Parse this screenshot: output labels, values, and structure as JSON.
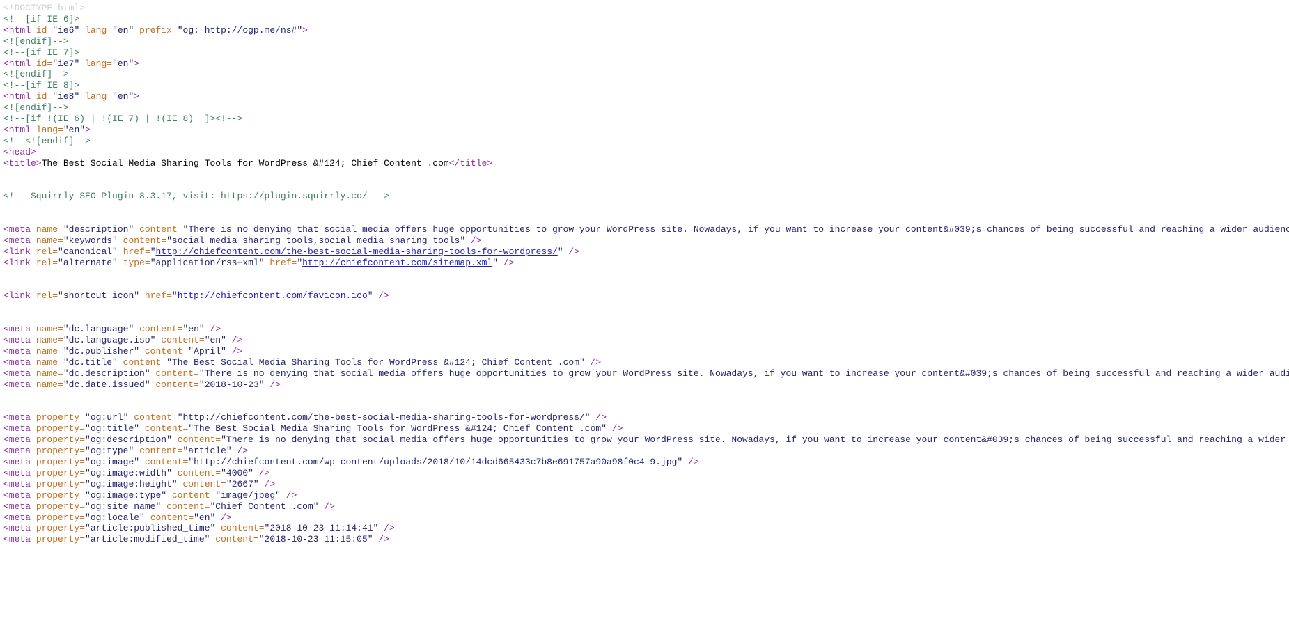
{
  "view": {
    "kind": "view-source",
    "title": "view-source page showing raw HTML of a WordPress article",
    "colors": {
      "background": "#ffffff",
      "doctype": "#cfcfcf",
      "comment": "#3f7f5f",
      "tag": "#8b2fa0",
      "attribute_name": "#c07020",
      "attribute_value": "#25256e",
      "hyperlink": "#2020c0"
    }
  },
  "source": {
    "lines": [
      {
        "id": 1,
        "type": "doctype",
        "text": "<!DOCTYPE html>"
      },
      {
        "id": 2,
        "type": "comment",
        "text": "<!--[if IE 6]>"
      },
      {
        "id": 3,
        "type": "tag",
        "tagname": "html",
        "attrs": [
          [
            "id",
            "ie6"
          ],
          [
            "lang",
            "en"
          ],
          [
            "prefix",
            "og: http://ogp.me/ns#"
          ]
        ],
        "close": ">"
      },
      {
        "id": 4,
        "type": "comment",
        "text": "<![endif]-->"
      },
      {
        "id": 5,
        "type": "comment",
        "text": "<!--[if IE 7]>"
      },
      {
        "id": 6,
        "type": "tag",
        "tagname": "html",
        "attrs": [
          [
            "id",
            "ie7"
          ],
          [
            "lang",
            "en"
          ]
        ],
        "close": ">"
      },
      {
        "id": 7,
        "type": "comment",
        "text": "<![endif]-->"
      },
      {
        "id": 8,
        "type": "comment",
        "text": "<!--[if IE 8]>"
      },
      {
        "id": 9,
        "type": "tag",
        "tagname": "html",
        "attrs": [
          [
            "id",
            "ie8"
          ],
          [
            "lang",
            "en"
          ]
        ],
        "close": ">"
      },
      {
        "id": 10,
        "type": "comment",
        "text": "<![endif]-->"
      },
      {
        "id": 11,
        "type": "comment",
        "text": "<!--[if !(IE 6) | !(IE 7) | !(IE 8)  ]><!-->"
      },
      {
        "id": 12,
        "type": "tag",
        "tagname": "html",
        "attrs": [
          [
            "lang",
            "en"
          ]
        ],
        "close": ">"
      },
      {
        "id": 13,
        "type": "comment",
        "text": "<!--<![endif]-->"
      },
      {
        "id": 14,
        "type": "tag",
        "tagname": "head",
        "attrs": [],
        "close": ">"
      },
      {
        "id": 15,
        "type": "title",
        "tagopen": "<title>",
        "text": "The Best Social Media Sharing Tools for WordPress &#124; Chief Content .com",
        "tagclose": "</title>"
      },
      {
        "id": 16,
        "type": "blank"
      },
      {
        "id": 17,
        "type": "blank"
      },
      {
        "id": 18,
        "type": "comment",
        "text": "<!-- Squirrly SEO Plugin 8.3.17, visit: https://plugin.squirrly.co/ -->"
      },
      {
        "id": 19,
        "type": "blank"
      },
      {
        "id": 20,
        "type": "blank"
      },
      {
        "id": 21,
        "type": "tag",
        "tagname": "meta",
        "attrs": [
          [
            "name",
            "description"
          ],
          [
            "content",
            "There is no denying that social media offers huge opportunities to grow your WordPress site. Nowadays, if you want to increase your content&#039;s chances of being successful and reaching a wider audience, you have to share it on social media. It&#039;s not just a good idea; it&#039;s imperative to do so in order to generate more"
          ]
        ],
        "close": " />"
      },
      {
        "id": 22,
        "type": "tag",
        "tagname": "meta",
        "attrs": [
          [
            "name",
            "keywords"
          ],
          [
            "content",
            "social media sharing tools,social media sharing tools"
          ]
        ],
        "close": " />"
      },
      {
        "id": 23,
        "type": "tag",
        "tagname": "link",
        "attrs": [
          [
            "rel",
            "canonical"
          ]
        ],
        "linkattr": [
          "href",
          "http://chiefcontent.com/the-best-social-media-sharing-tools-for-wordpress/"
        ],
        "close": " />"
      },
      {
        "id": 24,
        "type": "tag",
        "tagname": "link",
        "attrs": [
          [
            "rel",
            "alternate"
          ],
          [
            "type",
            "application/rss+xml"
          ]
        ],
        "linkattr": [
          "href",
          "http://chiefcontent.com/sitemap.xml"
        ],
        "close": " />"
      },
      {
        "id": 25,
        "type": "blank"
      },
      {
        "id": 26,
        "type": "blank"
      },
      {
        "id": 27,
        "type": "tag",
        "tagname": "link",
        "attrs": [
          [
            "rel",
            "shortcut icon"
          ]
        ],
        "linkattr": [
          "href",
          "http://chiefcontent.com/favicon.ico"
        ],
        "close": " />"
      },
      {
        "id": 28,
        "type": "blank"
      },
      {
        "id": 29,
        "type": "blank"
      },
      {
        "id": 30,
        "type": "tag",
        "tagname": "meta",
        "attrs": [
          [
            "name",
            "dc.language"
          ],
          [
            "content",
            "en"
          ]
        ],
        "close": " />"
      },
      {
        "id": 31,
        "type": "tag",
        "tagname": "meta",
        "attrs": [
          [
            "name",
            "dc.language.iso"
          ],
          [
            "content",
            "en"
          ]
        ],
        "close": " />"
      },
      {
        "id": 32,
        "type": "tag",
        "tagname": "meta",
        "attrs": [
          [
            "name",
            "dc.publisher"
          ],
          [
            "content",
            "April"
          ]
        ],
        "close": " />"
      },
      {
        "id": 33,
        "type": "tag",
        "tagname": "meta",
        "attrs": [
          [
            "name",
            "dc.title"
          ],
          [
            "content",
            "The Best Social Media Sharing Tools for WordPress &#124; Chief Content .com"
          ]
        ],
        "close": " />"
      },
      {
        "id": 34,
        "type": "tag",
        "tagname": "meta",
        "attrs": [
          [
            "name",
            "dc.description"
          ],
          [
            "content",
            "There is no denying that social media offers huge opportunities to grow your WordPress site. Nowadays, if you want to increase your content&#039;s chances of being successful and reaching a wider audience, you have to share it on social media. It&#039;s not just a good idea; it&#039;s imperative to do so in order to generate more"
          ]
        ],
        "close": " />"
      },
      {
        "id": 35,
        "type": "tag",
        "tagname": "meta",
        "attrs": [
          [
            "name",
            "dc.date.issued"
          ],
          [
            "content",
            "2018-10-23"
          ]
        ],
        "close": " />"
      },
      {
        "id": 36,
        "type": "blank"
      },
      {
        "id": 37,
        "type": "blank"
      },
      {
        "id": 38,
        "type": "tag",
        "tagname": "meta",
        "attrs": [
          [
            "property",
            "og:url"
          ],
          [
            "content",
            "http://chiefcontent.com/the-best-social-media-sharing-tools-for-wordpress/"
          ]
        ],
        "close": " />"
      },
      {
        "id": 39,
        "type": "tag",
        "tagname": "meta",
        "attrs": [
          [
            "property",
            "og:title"
          ],
          [
            "content",
            "The Best Social Media Sharing Tools for WordPress &#124; Chief Content .com"
          ]
        ],
        "close": " />"
      },
      {
        "id": 40,
        "type": "tag",
        "tagname": "meta",
        "attrs": [
          [
            "property",
            "og:description"
          ],
          [
            "content",
            "There is no denying that social media offers huge opportunities to grow your WordPress site. Nowadays, if you want to increase your content&#039;s chances of being successful and reaching a wider audience, you have to share it on social media. It&#039;s not just a good idea; it&#039;s imperative to do so in order to generate more"
          ]
        ],
        "close": " />"
      },
      {
        "id": 41,
        "type": "tag",
        "tagname": "meta",
        "attrs": [
          [
            "property",
            "og:type"
          ],
          [
            "content",
            "article"
          ]
        ],
        "close": " />"
      },
      {
        "id": 42,
        "type": "tag",
        "tagname": "meta",
        "attrs": [
          [
            "property",
            "og:image"
          ],
          [
            "content",
            "http://chiefcontent.com/wp-content/uploads/2018/10/14dcd665433c7b8e691757a90a98f0c4-9.jpg"
          ]
        ],
        "close": " />"
      },
      {
        "id": 43,
        "type": "tag",
        "tagname": "meta",
        "attrs": [
          [
            "property",
            "og:image:width"
          ],
          [
            "content",
            "4000"
          ]
        ],
        "close": " />"
      },
      {
        "id": 44,
        "type": "tag",
        "tagname": "meta",
        "attrs": [
          [
            "property",
            "og:image:height"
          ],
          [
            "content",
            "2667"
          ]
        ],
        "close": " />"
      },
      {
        "id": 45,
        "type": "tag",
        "tagname": "meta",
        "attrs": [
          [
            "property",
            "og:image:type"
          ],
          [
            "content",
            "image/jpeg"
          ]
        ],
        "close": " />"
      },
      {
        "id": 46,
        "type": "tag",
        "tagname": "meta",
        "attrs": [
          [
            "property",
            "og:site_name"
          ],
          [
            "content",
            "Chief Content .com"
          ]
        ],
        "close": " />"
      },
      {
        "id": 47,
        "type": "tag",
        "tagname": "meta",
        "attrs": [
          [
            "property",
            "og:locale"
          ],
          [
            "content",
            "en"
          ]
        ],
        "close": " />"
      },
      {
        "id": 48,
        "type": "tag",
        "tagname": "meta",
        "attrs": [
          [
            "property",
            "article:published_time"
          ],
          [
            "content",
            "2018-10-23 11:14:41"
          ]
        ],
        "close": " />"
      },
      {
        "id": 49,
        "type": "tag",
        "tagname": "meta",
        "attrs": [
          [
            "property",
            "article:modified_time"
          ],
          [
            "content",
            "2018-10-23 11:15:05"
          ]
        ],
        "close": " />"
      }
    ]
  }
}
